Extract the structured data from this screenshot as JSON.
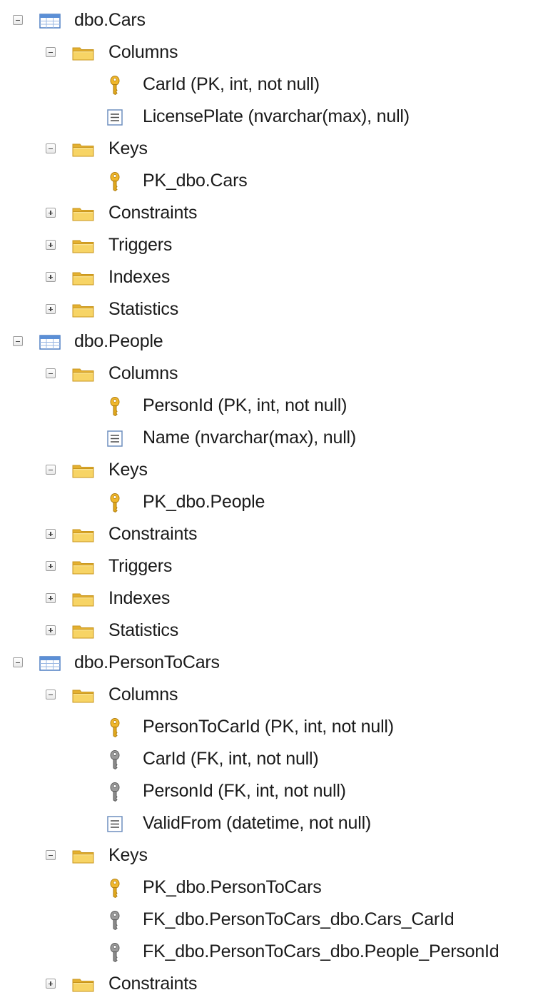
{
  "tree": [
    {
      "depth": 0,
      "expander": "collapse",
      "icon": "table-icon",
      "label": "dbo.Cars"
    },
    {
      "depth": 1,
      "expander": "collapse",
      "icon": "folder-icon",
      "label": "Columns"
    },
    {
      "depth": 2,
      "expander": "none",
      "icon": "primary-key-icon",
      "label": "CarId (PK, int, not null)"
    },
    {
      "depth": 2,
      "expander": "none",
      "icon": "column-icon",
      "label": "LicensePlate (nvarchar(max), null)"
    },
    {
      "depth": 1,
      "expander": "collapse",
      "icon": "folder-icon",
      "label": "Keys"
    },
    {
      "depth": 2,
      "expander": "none",
      "icon": "primary-key-icon",
      "label": "PK_dbo.Cars"
    },
    {
      "depth": 1,
      "expander": "expand",
      "icon": "folder-icon",
      "label": "Constraints"
    },
    {
      "depth": 1,
      "expander": "expand",
      "icon": "folder-icon",
      "label": "Triggers"
    },
    {
      "depth": 1,
      "expander": "expand",
      "icon": "folder-icon",
      "label": "Indexes"
    },
    {
      "depth": 1,
      "expander": "expand",
      "icon": "folder-icon",
      "label": "Statistics"
    },
    {
      "depth": 0,
      "expander": "collapse",
      "icon": "table-icon",
      "label": "dbo.People"
    },
    {
      "depth": 1,
      "expander": "collapse",
      "icon": "folder-icon",
      "label": "Columns"
    },
    {
      "depth": 2,
      "expander": "none",
      "icon": "primary-key-icon",
      "label": "PersonId (PK, int, not null)"
    },
    {
      "depth": 2,
      "expander": "none",
      "icon": "column-icon",
      "label": "Name (nvarchar(max), null)"
    },
    {
      "depth": 1,
      "expander": "collapse",
      "icon": "folder-icon",
      "label": "Keys"
    },
    {
      "depth": 2,
      "expander": "none",
      "icon": "primary-key-icon",
      "label": "PK_dbo.People"
    },
    {
      "depth": 1,
      "expander": "expand",
      "icon": "folder-icon",
      "label": "Constraints"
    },
    {
      "depth": 1,
      "expander": "expand",
      "icon": "folder-icon",
      "label": "Triggers"
    },
    {
      "depth": 1,
      "expander": "expand",
      "icon": "folder-icon",
      "label": "Indexes"
    },
    {
      "depth": 1,
      "expander": "expand",
      "icon": "folder-icon",
      "label": "Statistics"
    },
    {
      "depth": 0,
      "expander": "collapse",
      "icon": "table-icon",
      "label": "dbo.PersonToCars"
    },
    {
      "depth": 1,
      "expander": "collapse",
      "icon": "folder-icon",
      "label": "Columns"
    },
    {
      "depth": 2,
      "expander": "none",
      "icon": "primary-key-icon",
      "label": "PersonToCarId (PK, int, not null)"
    },
    {
      "depth": 2,
      "expander": "none",
      "icon": "foreign-key-icon",
      "label": "CarId (FK, int, not null)"
    },
    {
      "depth": 2,
      "expander": "none",
      "icon": "foreign-key-icon",
      "label": "PersonId (FK, int, not null)"
    },
    {
      "depth": 2,
      "expander": "none",
      "icon": "column-icon",
      "label": "ValidFrom (datetime, not null)"
    },
    {
      "depth": 1,
      "expander": "collapse",
      "icon": "folder-icon",
      "label": "Keys"
    },
    {
      "depth": 2,
      "expander": "none",
      "icon": "primary-key-icon",
      "label": "PK_dbo.PersonToCars"
    },
    {
      "depth": 2,
      "expander": "none",
      "icon": "foreign-key-icon",
      "label": "FK_dbo.PersonToCars_dbo.Cars_CarId"
    },
    {
      "depth": 2,
      "expander": "none",
      "icon": "foreign-key-icon",
      "label": "FK_dbo.PersonToCars_dbo.People_PersonId"
    },
    {
      "depth": 1,
      "expander": "expand",
      "icon": "folder-icon",
      "label": "Constraints"
    }
  ],
  "colors": {
    "folder": "#f2c849",
    "table": "#5b8fd6",
    "primary_key": "#e0a81c",
    "foreign_key": "#8a8a8a",
    "column": "#6f8fbf"
  }
}
